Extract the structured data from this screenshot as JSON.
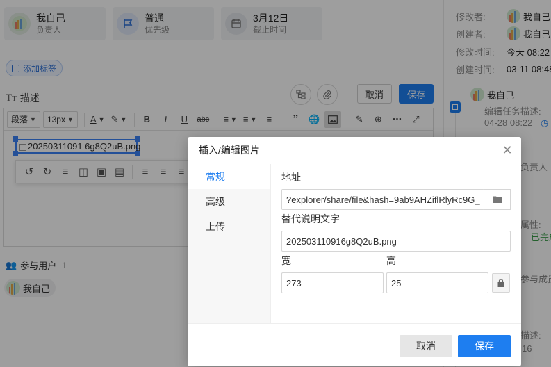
{
  "cards": {
    "assignee": {
      "name": "我自己",
      "label": "负责人"
    },
    "priority": {
      "value": "普通",
      "label": "优先级"
    },
    "deadline": {
      "value": "3月12日",
      "label": "截止时间"
    }
  },
  "tags": {
    "add_label": "添加标签"
  },
  "description": {
    "title": "描述",
    "cancel_label": "取消",
    "save_label": "保存"
  },
  "toolbar": {
    "paragraph": "段落",
    "font_size": "13px"
  },
  "editor": {
    "image_alt": "20250311091 6g8Q2uB.png"
  },
  "participants": {
    "title": "参与用户",
    "count": "1",
    "users": [
      {
        "name": "我自己"
      }
    ]
  },
  "meta": {
    "modifier_label": "修改者:",
    "modifier": "我自己",
    "creator_label": "创建者:",
    "creator": "我自己",
    "modified_label": "修改时间:",
    "modified": "今天 08:22",
    "created_label": "创建时间:",
    "created": "03-11 08:48"
  },
  "timeline": {
    "user": "我自己",
    "action": "编辑任务描述:",
    "time": "04-28 08:22",
    "frag1": "负责人",
    "frag2": "属性:",
    "frag3": "已完成",
    "frag4": "参与成员",
    "frag5": "描述:",
    "frag6": "16"
  },
  "dialog": {
    "title": "插入/编辑图片",
    "tabs": [
      "常规",
      "高级",
      "上传"
    ],
    "url_label": "地址",
    "url_value": "?explorer/share/file&hash=9ab9AHZiflRlyRc9G_",
    "alt_label": "替代说明文字",
    "alt_value": "202503110916g8Q2uB.png",
    "width_label": "宽",
    "width_value": "273",
    "height_label": "高",
    "height_value": "25",
    "cancel_label": "取消",
    "save_label": "保存"
  },
  "colors": {
    "accent": "#1e7ef0",
    "overlay": "rgba(0,0,0,0.38)"
  }
}
